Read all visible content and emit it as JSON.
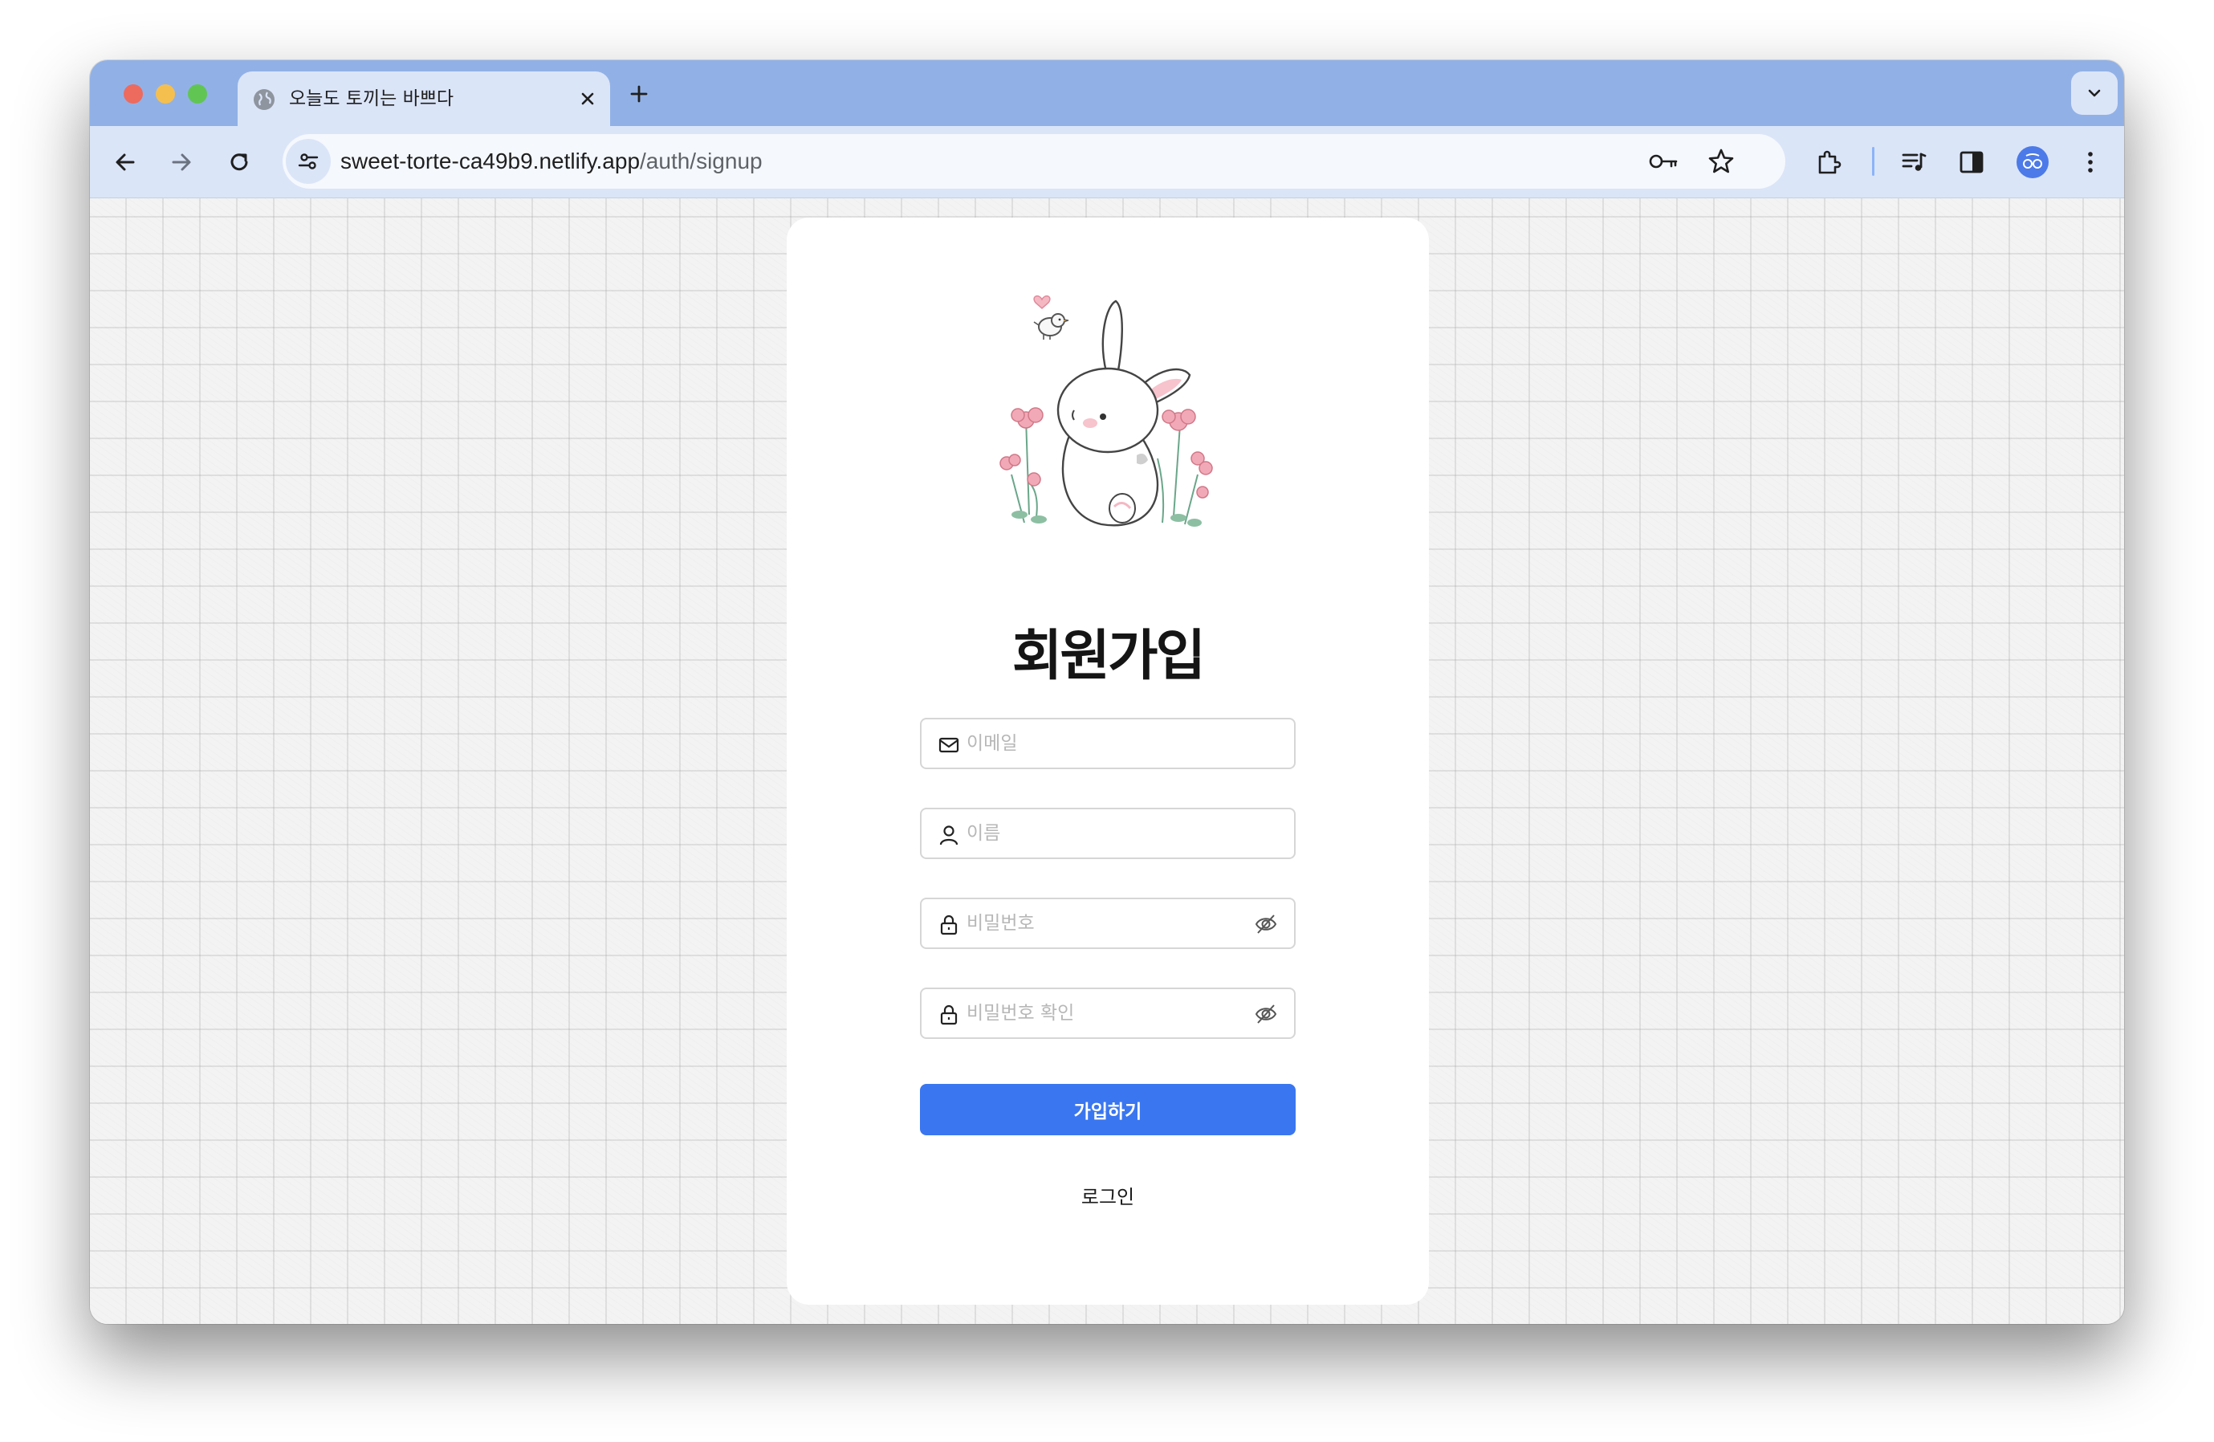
{
  "browser": {
    "tab_title": "오늘도 토끼는 바쁘다",
    "url_host": "sweet-torte-ca49b9.netlify.app",
    "url_path": "/auth/signup",
    "icons": {
      "back": "arrow-left-icon",
      "forward": "arrow-right-icon",
      "reload": "reload-icon",
      "site_info": "tune-icon",
      "password": "key-icon",
      "bookmark": "star-icon",
      "extensions": "puzzle-icon",
      "media": "media-queue-icon",
      "side_panel": "side-panel-icon",
      "menu": "kebab-menu-icon"
    },
    "colors": {
      "tabstrip": "#91b1e6",
      "toolbar": "#dbe5f8"
    }
  },
  "signup": {
    "title": "회원가입",
    "fields": {
      "email_placeholder": "이메일",
      "name_placeholder": "이름",
      "password_placeholder": "비밀번호",
      "password_confirm_placeholder": "비밀번호 확인"
    },
    "submit_label": "가입하기",
    "login_link": "로그인",
    "accent_color": "#3a76f0"
  }
}
